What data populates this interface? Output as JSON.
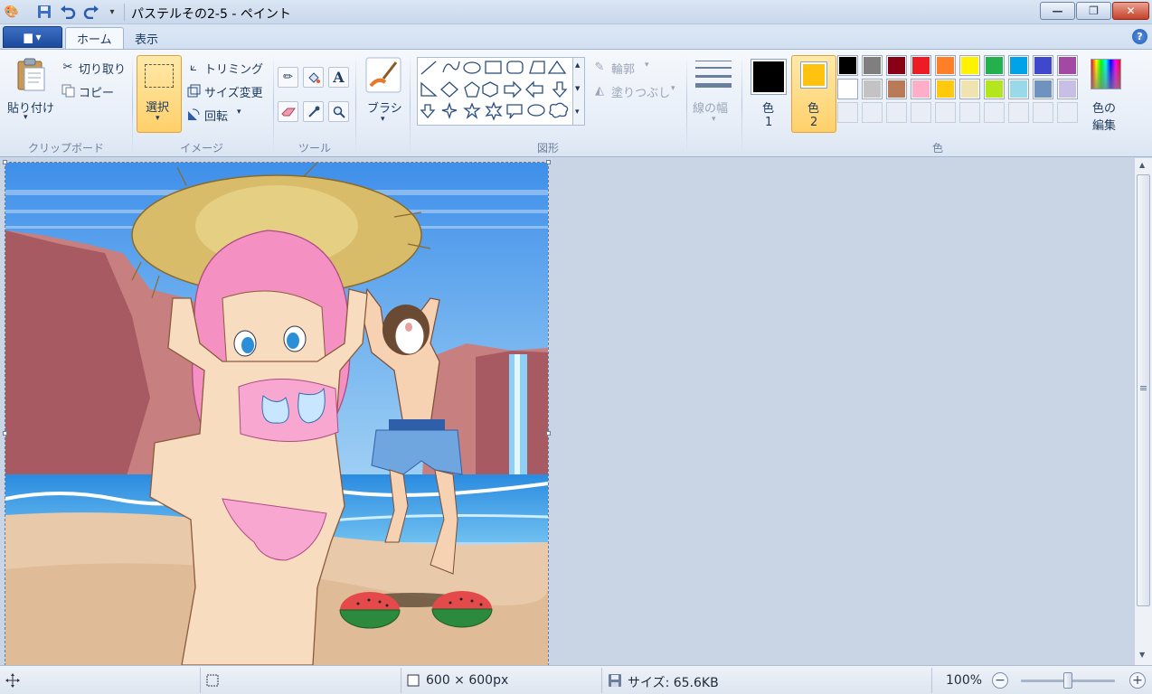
{
  "window": {
    "title": "パステルその2-5 - ペイント",
    "buttons": {
      "minimize": "—",
      "maximize": "❐",
      "close": "✕"
    }
  },
  "quick_access": [
    {
      "name": "paint-app-icon",
      "glyph": "🎨"
    },
    {
      "name": "save-icon",
      "glyph": "💾"
    },
    {
      "name": "undo-icon",
      "glyph": "↶"
    },
    {
      "name": "redo-icon",
      "glyph": "↷"
    },
    {
      "name": "customize-icon",
      "glyph": "▾"
    }
  ],
  "tabs": {
    "file_menu": "▆ ▾",
    "home": "ホーム",
    "view": "表示"
  },
  "help": "?",
  "clipboard": {
    "paste": "貼り付け",
    "cut": "切り取り",
    "copy": "コピー",
    "group": "クリップボード"
  },
  "image": {
    "select": "選択",
    "crop": "トリミング",
    "resize": "サイズ変更",
    "rotate": "回転",
    "group": "イメージ"
  },
  "tools": {
    "group": "ツール"
  },
  "brushes": {
    "label": "ブラシ"
  },
  "shapes": {
    "outline": "輪郭",
    "fill": "塗りつぶし",
    "group": "図形"
  },
  "size": {
    "label": "線の幅"
  },
  "colors": {
    "color1_line1": "色",
    "color1_line2": "1",
    "color2_line1": "色",
    "color2_line2": "2",
    "edit_line1": "色の",
    "edit_line2": "編集",
    "group": "色",
    "color1_value": "#000000",
    "color2_value": "#ffc20e",
    "palette_row1": [
      "#000000",
      "#7f7f7f",
      "#880015",
      "#ed1c24",
      "#ff7f27",
      "#fff200",
      "#22b14c",
      "#00a2e8",
      "#3f48cc",
      "#a349a4"
    ],
    "palette_row2": [
      "#ffffff",
      "#c3c3c3",
      "#b97a57",
      "#ffaec9",
      "#ffc90e",
      "#efe4b0",
      "#b5e61d",
      "#99d9ea",
      "#7092be",
      "#c8bfe7"
    ]
  },
  "status": {
    "canvas_size": "600 × 600px",
    "file_size": "サイズ: 65.6KB",
    "zoom": "100%"
  }
}
